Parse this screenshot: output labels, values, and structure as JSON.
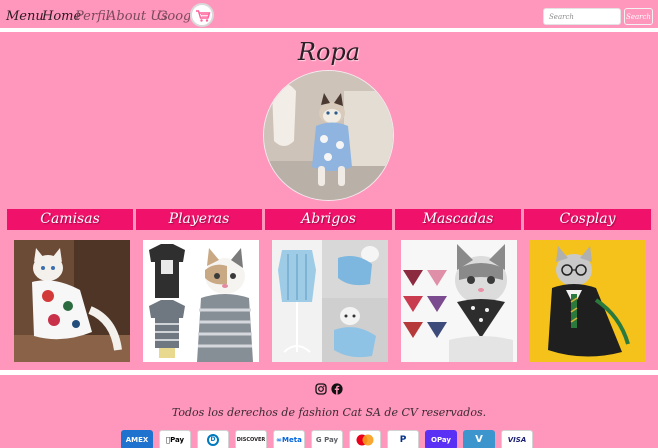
{
  "nav": {
    "menu_label": "Menu",
    "home_label": "Home",
    "perfil_label": "Perfil",
    "about_label": "About Us",
    "google_label": "Google",
    "cart_icon": "shopping-cart-icon",
    "search_placeholder": "Search",
    "search_button": "Search"
  },
  "page_title": "Ropa",
  "categories": [
    {
      "label": "Camisas"
    },
    {
      "label": "Playeras"
    },
    {
      "label": "Abrigos"
    },
    {
      "label": "Mascadas"
    },
    {
      "label": "Cosplay"
    }
  ],
  "footer": {
    "social_icons": [
      "instagram-icon",
      "facebook-icon"
    ],
    "copyright": "Todos los derechos de fashion Cat SA de CV reservados.",
    "payment_methods": [
      {
        "label": "AMEX",
        "color": "#1f72cd"
      },
      {
        "label": "Pay",
        "color": "#000000"
      },
      {
        "label": "D",
        "color": "#0079be"
      },
      {
        "label": "DISCOVER",
        "color": "#f58220"
      },
      {
        "label": "Meta",
        "color": "#0064e0"
      },
      {
        "label": "G Pay",
        "color": "#5f6368"
      },
      {
        "label": "",
        "color": "#eb001b"
      },
      {
        "label": "P",
        "color": "#003087"
      },
      {
        "label": "OPay",
        "color": "#5a31f4"
      },
      {
        "label": "V",
        "color": "#3d95ce"
      },
      {
        "label": "VISA",
        "color": "#1a1f71"
      }
    ]
  },
  "colors": {
    "background": "#ff96bc",
    "category_bar": "#f0116b",
    "divider": "#ffffff"
  }
}
